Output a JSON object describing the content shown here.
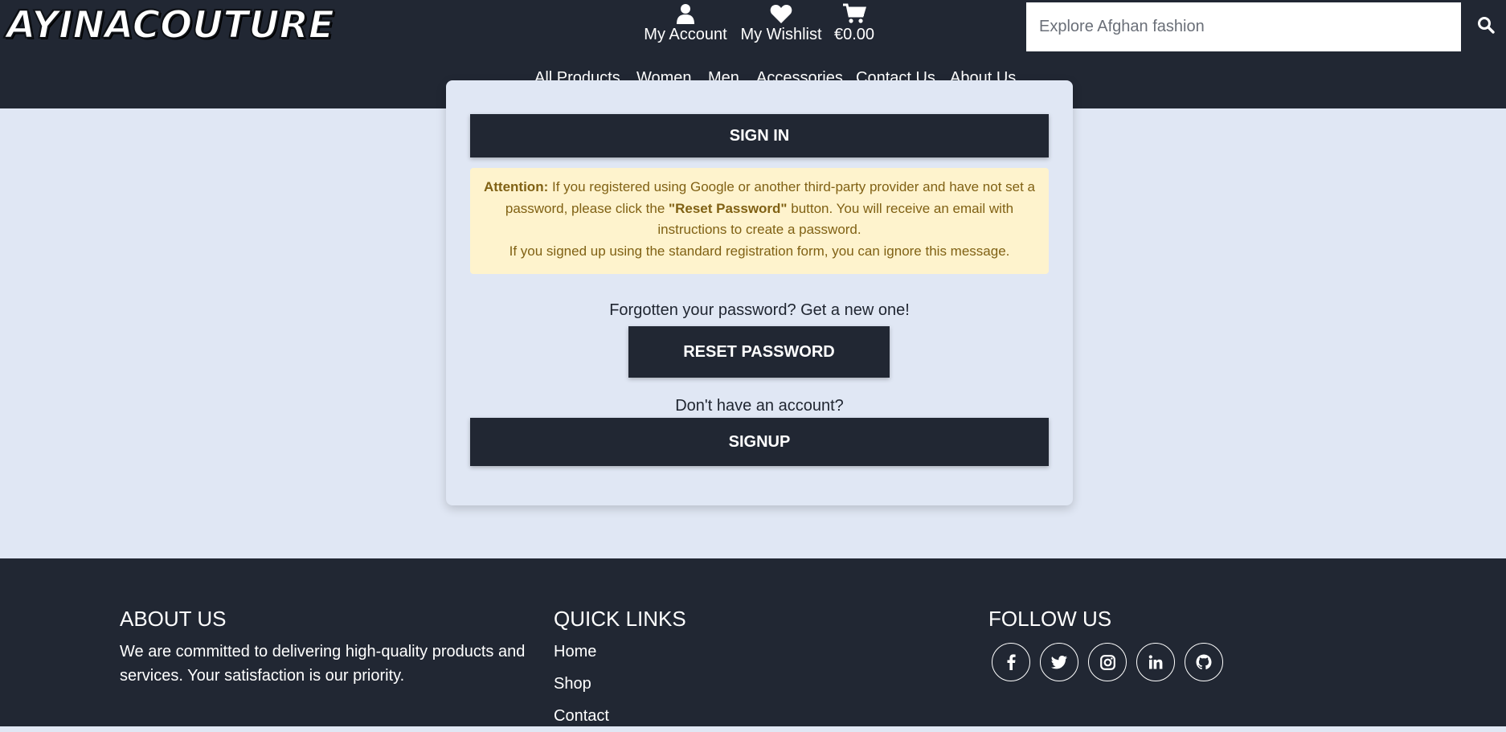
{
  "brand": {
    "logo_text": "AYINACOUTURE"
  },
  "header": {
    "account_label": "My Account",
    "wishlist_label": "My Wishlist",
    "cart_total": "€0.00",
    "search_placeholder": "Explore Afghan fashion"
  },
  "nav": {
    "items": [
      "All Products",
      "Women",
      "Men",
      "Accessories",
      "Contact Us",
      "About Us"
    ]
  },
  "signin": {
    "sign_in_label": "SIGN IN",
    "alert_bold_prefix": "Attention:",
    "alert_text_1": "If you registered using Google or another third-party provider and have not set a password, please click the",
    "alert_bold_mid": "\"Reset Password\"",
    "alert_text_2": "button. You will receive an email with instructions to create a password.",
    "alert_text_3": "If you signed up using the standard registration form, you can ignore this message.",
    "forgot_text": "Forgotten your password? Get a new one!",
    "reset_label": "RESET PASSWORD",
    "no_account_text": "Don't have an account?",
    "signup_label": "SIGNUP"
  },
  "footer": {
    "about_heading": "ABOUT US",
    "about_text": "We are committed to delivering high-quality products and services. Your satisfaction is our priority.",
    "links_heading": "QUICK LINKS",
    "links": [
      "Home",
      "Shop",
      "Contact"
    ],
    "follow_heading": "FOLLOW US",
    "socials": [
      "facebook-icon",
      "twitter-icon",
      "instagram-icon",
      "linkedin-icon",
      "github-icon"
    ]
  },
  "colors": {
    "dark": "#212733",
    "page_bg": "#e0e7f4",
    "alert_bg": "#fef3cd",
    "alert_text": "#806114"
  }
}
